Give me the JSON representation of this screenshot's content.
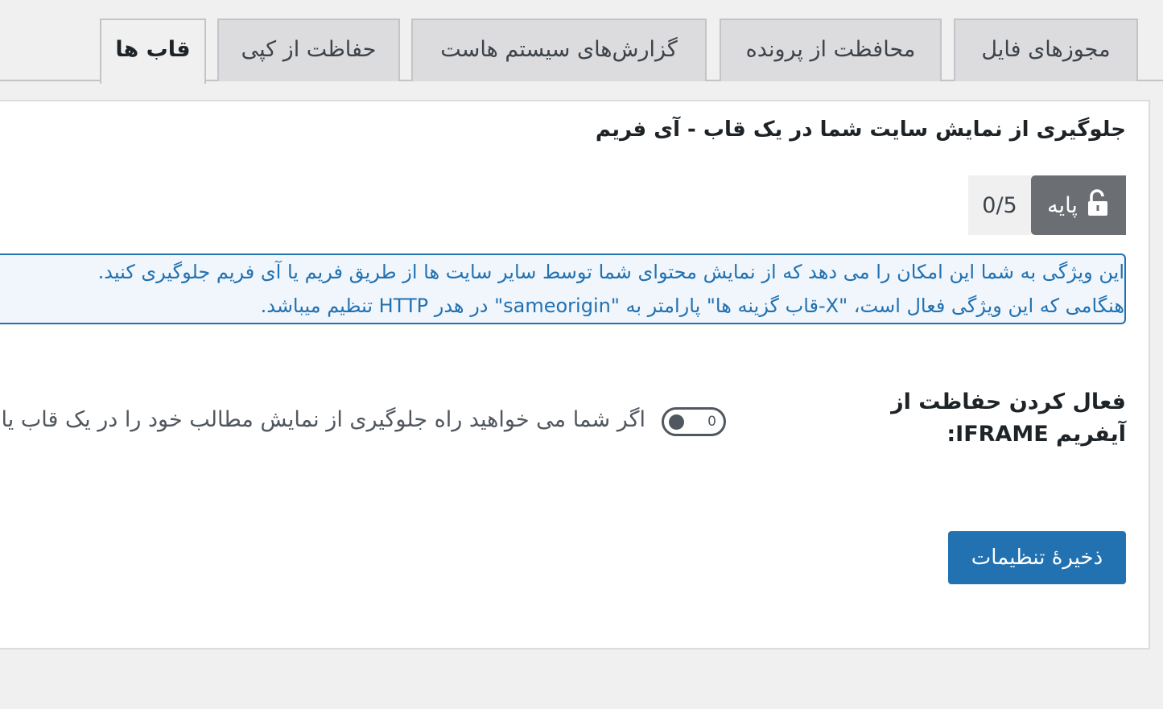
{
  "tabs": [
    {
      "label": "مجوزهای فایل",
      "active": false
    },
    {
      "label": "محافظت از پرونده",
      "active": false
    },
    {
      "label": "گزارش‌های سیستم هاست",
      "active": false
    },
    {
      "label": "حفاظت از کپی",
      "active": false
    },
    {
      "label": "قاب ها",
      "active": true
    }
  ],
  "section": {
    "title": "جلوگیری از نمایش سایت شما در یک قاب - آی فریم"
  },
  "level": {
    "icon": "unlock-icon",
    "label": "پایه",
    "score": "0/5"
  },
  "notice": {
    "line1": "این ویژگی به شما این امکان را می دهد که از نمایش محتوای شما توسط سایر سایت ها از طریق فریم یا آی فریم جلوگیری کنید.",
    "line2": "هنگامی که این ویژگی فعال است، \"X-قاب گزینه ها\" پارامتر به \"sameorigin\" در هدر HTTP تنظیم میباشد."
  },
  "field": {
    "label": "فعال کردن حفاظت از آیفریم IFRAME:",
    "toggle_state": "0",
    "toggle_on": false,
    "description": "اگر شما می خواهید راه جلوگیری از نمایش مطالب خود را در یک قاب یا آی فریم فعال کنید این گزینه را فعال کنید."
  },
  "save_button": {
    "label": "ذخیرهٔ تنظیمات"
  },
  "colors": {
    "accent": "#2271b1",
    "notice_bg": "#f0f6fc",
    "badge_bg": "#6b6e72",
    "page_bg": "#f0f0f1"
  }
}
